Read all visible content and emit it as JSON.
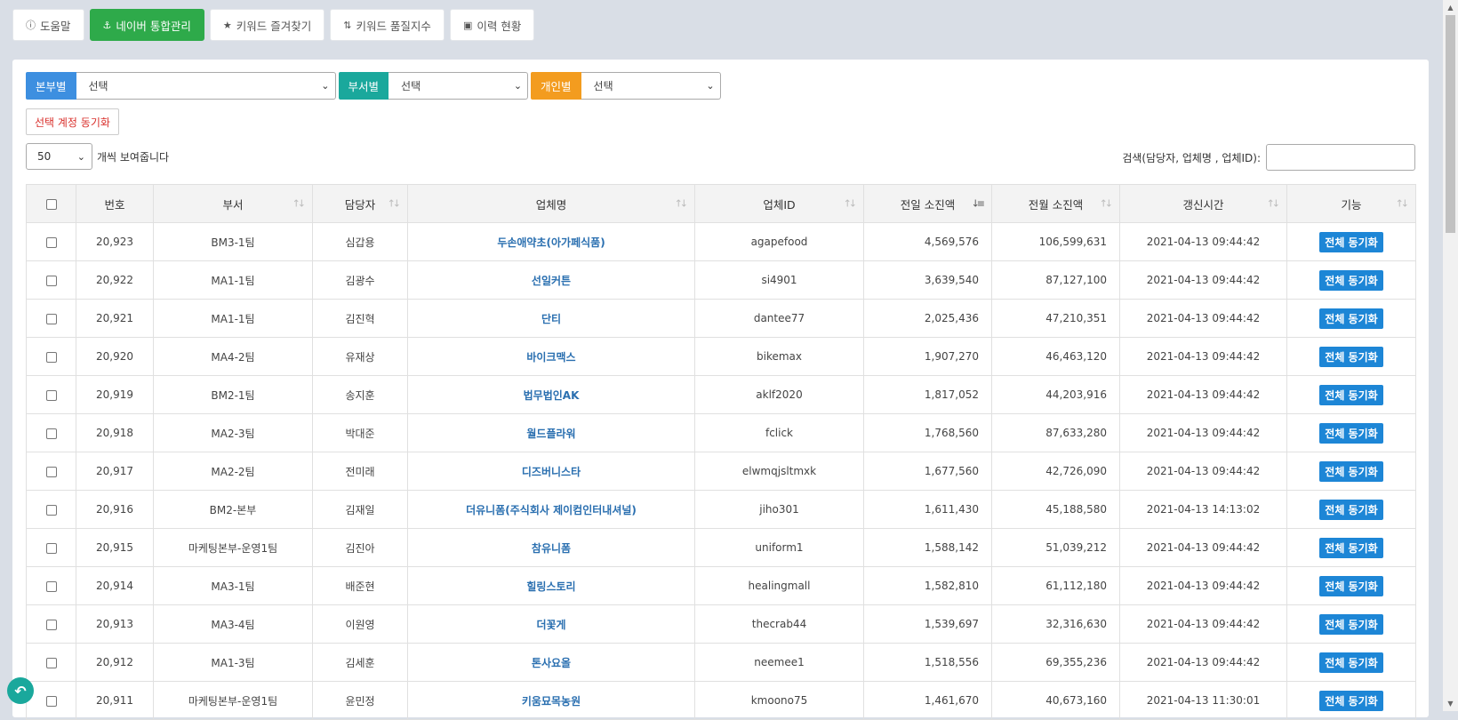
{
  "nav": {
    "help": {
      "label": "도움말",
      "icon": "info-icon"
    },
    "naver": {
      "label": "네이버 통합관리",
      "icon": "anchor-icon"
    },
    "keyword_fav": {
      "label": "키워드 즐겨찾기",
      "icon": "star-icon"
    },
    "keyword_quality": {
      "label": "키워드 품질지수",
      "icon": "sort-icon"
    },
    "history": {
      "label": "이력 현황",
      "icon": "inbox-icon"
    }
  },
  "filters": {
    "division": {
      "label": "본부별",
      "value": "선택",
      "color": "#3d8fe0"
    },
    "department": {
      "label": "부서별",
      "value": "선택",
      "color": "#1aa89c"
    },
    "person": {
      "label": "개인별",
      "value": "선택",
      "color": "#f39c1f"
    }
  },
  "sync_selected_label": "선택 계정 동기화",
  "length": {
    "value": "50",
    "suffix": "개씩 보여줍니다"
  },
  "search": {
    "label": "검색(담당자, 업체명 , 업체ID):",
    "value": ""
  },
  "table": {
    "columns": [
      "번호",
      "부서",
      "담당자",
      "업체명",
      "업체ID",
      "전일 소진액",
      "전월 소진액",
      "갱신시간",
      "기능"
    ],
    "rows": [
      {
        "no": "20,923",
        "dept": "BM3-1팀",
        "manager": "심갑용",
        "biz": "두손애약초(아가페식품)",
        "id": "agapefood",
        "prev_day": "4,569,576",
        "prev_month": "106,599,631",
        "updated": "2021-04-13 09:44:42",
        "action": "전체 동기화"
      },
      {
        "no": "20,922",
        "dept": "MA1-1팀",
        "manager": "김광수",
        "biz": "선일커튼",
        "id": "si4901",
        "prev_day": "3,639,540",
        "prev_month": "87,127,100",
        "updated": "2021-04-13 09:44:42",
        "action": "전체 동기화"
      },
      {
        "no": "20,921",
        "dept": "MA1-1팀",
        "manager": "김진혁",
        "biz": "단티",
        "id": "dantee77",
        "prev_day": "2,025,436",
        "prev_month": "47,210,351",
        "updated": "2021-04-13 09:44:42",
        "action": "전체 동기화"
      },
      {
        "no": "20,920",
        "dept": "MA4-2팀",
        "manager": "유재상",
        "biz": "바이크맥스",
        "id": "bikemax",
        "prev_day": "1,907,270",
        "prev_month": "46,463,120",
        "updated": "2021-04-13 09:44:42",
        "action": "전체 동기화"
      },
      {
        "no": "20,919",
        "dept": "BM2-1팀",
        "manager": "송지훈",
        "biz": "법무법인AK",
        "id": "aklf2020",
        "prev_day": "1,817,052",
        "prev_month": "44,203,916",
        "updated": "2021-04-13 09:44:42",
        "action": "전체 동기화"
      },
      {
        "no": "20,918",
        "dept": "MA2-3팀",
        "manager": "박대준",
        "biz": "월드플라워",
        "id": "fclick",
        "prev_day": "1,768,560",
        "prev_month": "87,633,280",
        "updated": "2021-04-13 09:44:42",
        "action": "전체 동기화"
      },
      {
        "no": "20,917",
        "dept": "MA2-2팀",
        "manager": "전미래",
        "biz": "디즈버니스타",
        "id": "elwmqjsltmxk",
        "prev_day": "1,677,560",
        "prev_month": "42,726,090",
        "updated": "2021-04-13 09:44:42",
        "action": "전체 동기화"
      },
      {
        "no": "20,916",
        "dept": "BM2-본부",
        "manager": "김재일",
        "biz": "더유니폼(주식회사 제이컴인터내셔널)",
        "id": "jiho301",
        "prev_day": "1,611,430",
        "prev_month": "45,188,580",
        "updated": "2021-04-13 14:13:02",
        "action": "전체 동기화"
      },
      {
        "no": "20,915",
        "dept": "마케팅본부-운영1팀",
        "manager": "김진아",
        "biz": "참유니폼",
        "id": "uniform1",
        "prev_day": "1,588,142",
        "prev_month": "51,039,212",
        "updated": "2021-04-13 09:44:42",
        "action": "전체 동기화"
      },
      {
        "no": "20,914",
        "dept": "MA3-1팀",
        "manager": "배준현",
        "biz": "힐링스토리",
        "id": "healingmall",
        "prev_day": "1,582,810",
        "prev_month": "61,112,180",
        "updated": "2021-04-13 09:44:42",
        "action": "전체 동기화"
      },
      {
        "no": "20,913",
        "dept": "MA3-4팀",
        "manager": "이원영",
        "biz": "더꽃게",
        "id": "thecrab44",
        "prev_day": "1,539,697",
        "prev_month": "32,316,630",
        "updated": "2021-04-13 09:44:42",
        "action": "전체 동기화"
      },
      {
        "no": "20,912",
        "dept": "MA1-3팀",
        "manager": "김세훈",
        "biz": "톤사요올",
        "id": "neemee1",
        "prev_day": "1,518,556",
        "prev_month": "69,355,236",
        "updated": "2021-04-13 09:44:42",
        "action": "전체 동기화"
      },
      {
        "no": "20,911",
        "dept": "마케팅본부-운영1팀",
        "manager": "윤민정",
        "biz": "키움묘목농원",
        "id": "kmoono75",
        "prev_day": "1,461,670",
        "prev_month": "40,673,160",
        "updated": "2021-04-13 11:30:01",
        "action": "전체 동기화"
      }
    ]
  }
}
